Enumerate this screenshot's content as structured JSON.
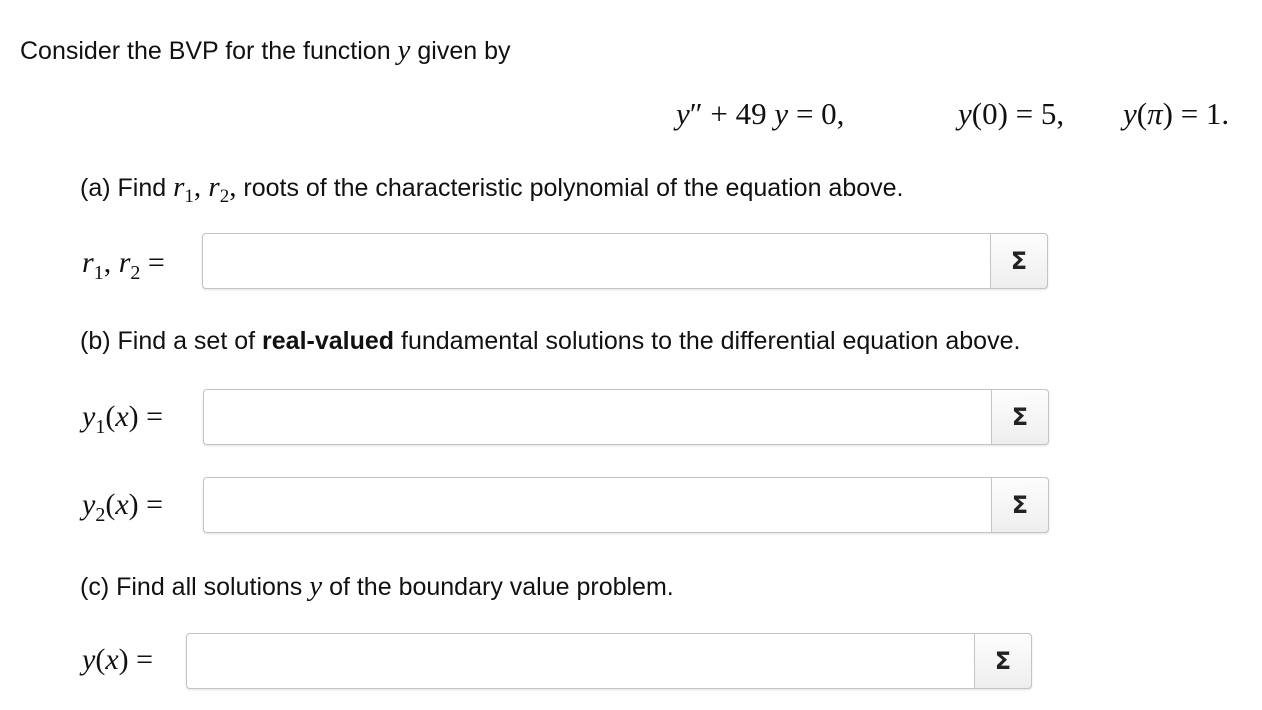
{
  "intro": {
    "before": "Consider the BVP for the function ",
    "var": "y",
    "after": " given by"
  },
  "equation": {
    "ode": "y″ + 49 y = 0,",
    "bc1": "y(0) = 5,",
    "bc2": "y(π) = 1."
  },
  "part_a": {
    "prefix": "(a) Find ",
    "vars": "r₁, r₂,",
    "suffix": " roots of the characteristic polynomial of the equation above."
  },
  "part_b": {
    "prefix": "(b) Find a set of ",
    "bold": "real-valued",
    "suffix": " fundamental solutions to the differential equation above."
  },
  "part_c": {
    "prefix": "(c) Find all solutions ",
    "var": "y",
    "suffix": " of the boundary value problem."
  },
  "fields": {
    "r1r2": {
      "label": "r1, r2 =",
      "value": "",
      "button": "Σ"
    },
    "y1": {
      "label": "y1(x) =",
      "value": "",
      "button": "Σ"
    },
    "y2": {
      "label": "y2(x) =",
      "value": "",
      "button": "Σ"
    },
    "y": {
      "label": "y(x) =",
      "value": "",
      "button": "Σ"
    }
  }
}
